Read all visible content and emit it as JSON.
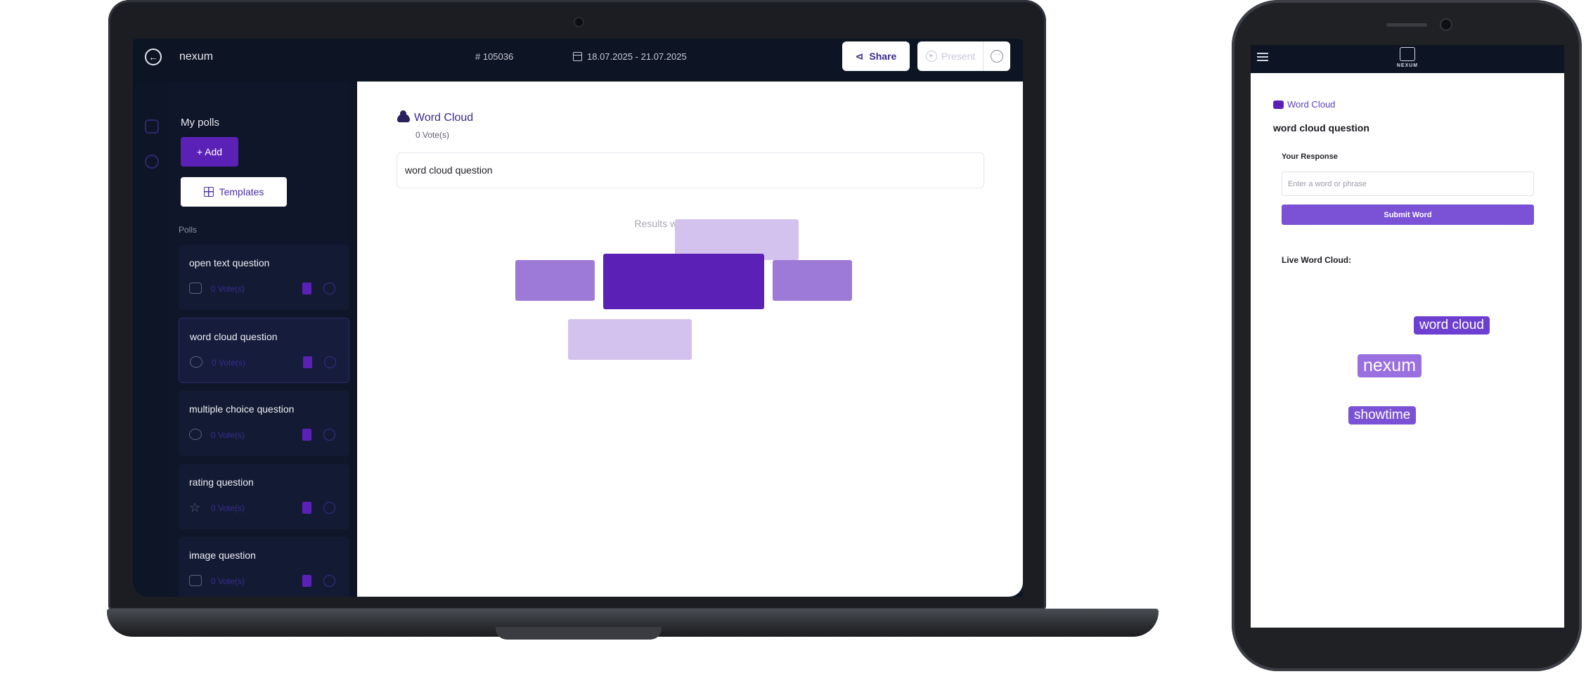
{
  "laptop": {
    "app_name": "nexum",
    "session_id": "# 105036",
    "date_range": "18.07.2025 - 21.07.2025",
    "share_label": "Share",
    "present_label": "Present",
    "sidebar": {
      "title": "My polls",
      "add_label": "+ Add",
      "templates_label": "Templates",
      "section_label": "Polls",
      "polls": [
        {
          "name": "open text question",
          "votes": "0 Vote(s)",
          "icon": "message-icon"
        },
        {
          "name": "word cloud question",
          "votes": "0 Vote(s)",
          "icon": "cloud-icon"
        },
        {
          "name": "multiple choice question",
          "votes": "0 Vote(s)",
          "icon": "choice-icon"
        },
        {
          "name": "rating question",
          "votes": "0 Vote(s)",
          "icon": "star-icon"
        },
        {
          "name": "image question",
          "votes": "0 Vote(s)",
          "icon": "image-icon"
        }
      ]
    },
    "main": {
      "poll_type": "Word Cloud",
      "votes": "0 Vote(s)",
      "question": "word cloud question",
      "results_hint": "Results will appear below"
    }
  },
  "phone": {
    "logo_text": "NEXUM",
    "poll_type": "Word Cloud",
    "question": "word cloud question",
    "response_label": "Your Response",
    "input_placeholder": "Enter a word or phrase",
    "submit_label": "Submit Word",
    "live_label": "Live Word Cloud:",
    "words": [
      "word cloud",
      "nexum",
      "showtime"
    ]
  },
  "colors": {
    "brand_purple": "#5b21b6",
    "light_purple": "#7b52d6",
    "navy": "#0e1526"
  }
}
